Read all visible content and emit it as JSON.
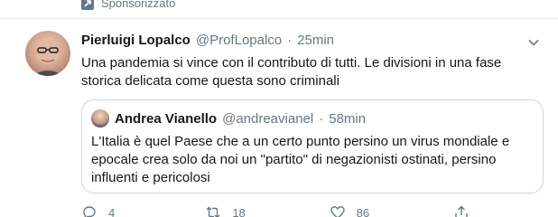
{
  "sponsored": {
    "label": "Sponsorizzato"
  },
  "tweet": {
    "author_name": "Pierluigi Lopalco",
    "author_handle": "@ProfLopalco",
    "separator": "·",
    "time": "25min",
    "text": "Una pandemia si vince con il contributo di tutti. Le divisioni in una fase storica delicata come questa sono criminali"
  },
  "quoted": {
    "author_name": "Andrea Vianello",
    "author_handle": "@andreavianel",
    "separator": "·",
    "time": "58min",
    "text": "L'Italia è quel Paese che a un certo punto persino un virus mondiale e epocale crea solo da noi un \"partito\" di negazionisti ostinati, persino influenti e pericolosi"
  },
  "actions": {
    "reply_count": "4",
    "retweet_count": "18",
    "like_count": "86"
  },
  "colors": {
    "secondary_text": "#657786",
    "border": "#ccd6dd"
  }
}
